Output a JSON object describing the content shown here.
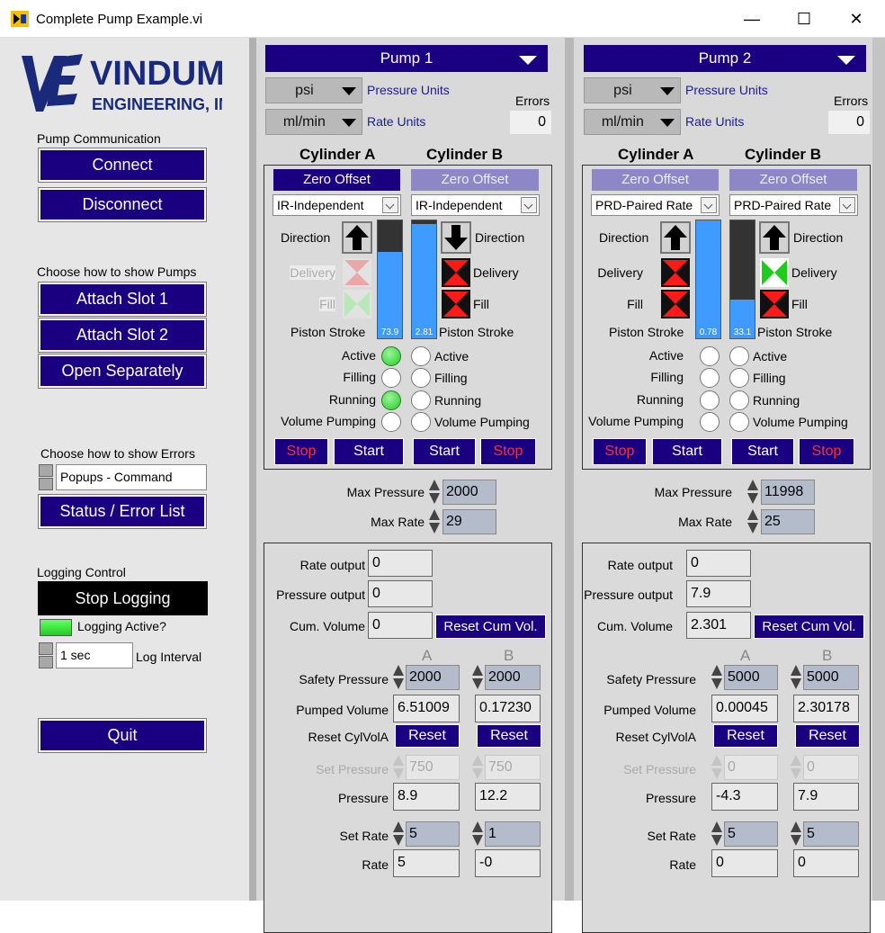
{
  "window": {
    "title": "Complete Pump Example.vi",
    "minimize": "—",
    "maximize": "☐",
    "close": "✕"
  },
  "left": {
    "logo": {
      "line1": "VINDUM",
      "line2": "ENGINEERING, INC."
    },
    "comm_label": "Pump Communication",
    "connect": "Connect",
    "disconnect": "Disconnect",
    "show_pumps_label": "Choose how to show Pumps",
    "attach1": "Attach Slot 1",
    "attach2": "Attach Slot 2",
    "open_sep": "Open Separately",
    "show_errors_label": "Choose how to show Errors",
    "error_mode": "Popups - Command",
    "status_list": "Status / Error List",
    "logging_label": "Logging Control",
    "stop_logging": "Stop Logging",
    "logging_active": "Logging Active?",
    "log_interval_value": "1 sec",
    "log_interval_label": "Log Interval",
    "quit": "Quit"
  },
  "common": {
    "pressure_units": "Pressure Units",
    "rate_units": "Rate Units",
    "errors": "Errors",
    "cylA": "Cylinder A",
    "cylB": "Cylinder B",
    "zero_offset": "Zero Offset",
    "direction": "Direction",
    "delivery": "Delivery",
    "fill": "Fill",
    "piston_stroke": "Piston Stroke",
    "active": "Active",
    "filling": "Filling",
    "running": "Running",
    "volume_pumping": "Volume Pumping",
    "stop": "Stop",
    "start": "Start",
    "max_pressure": "Max Pressure",
    "max_rate": "Max Rate",
    "rate_output": "Rate output",
    "pressure_output": "Pressure output",
    "cum_volume": "Cum. Volume",
    "reset_cum": "Reset Cum Vol.",
    "A": "A",
    "B": "B",
    "safety_pressure": "Safety Pressure",
    "pumped_volume": "Pumped Volume",
    "reset_cylvol": "Reset CylVolA",
    "reset": "Reset",
    "set_pressure": "Set Pressure",
    "pressure": "Pressure",
    "set_rate": "Set Rate",
    "rate": "Rate"
  },
  "pump1": {
    "name": "Pump 1",
    "p_unit": "psi",
    "r_unit": "ml/min",
    "errors": "0",
    "modeA": "IR-Independent",
    "modeB": "IR-Independent",
    "strokeA": "73.9",
    "strokeA_level": 0.73,
    "strokeB": "2.81",
    "strokeB_level": 0.97,
    "max_pressure": "2000",
    "max_rate": "29",
    "rate_output": "0",
    "pressure_output": "0",
    "cum_volume": "0",
    "safetyA": "2000",
    "safetyB": "2000",
    "pumpedA": "6.51009",
    "pumpedB": "0.17230",
    "setpA": "750",
    "setpB": "750",
    "pressA": "8.9",
    "pressB": "12.2",
    "setrA": "5",
    "setrB": "1",
    "rateA": "5",
    "rateB": "-0"
  },
  "pump2": {
    "name": "Pump 2",
    "p_unit": "psi",
    "r_unit": "ml/min",
    "errors": "0",
    "modeA": "PRD-Paired Rate",
    "modeB": "PRD-Paired Rate",
    "strokeA": "0.78",
    "strokeA_level": 1.0,
    "strokeB": "33.1",
    "strokeB_level": 0.33,
    "max_pressure": "11998",
    "max_rate": "25",
    "rate_output": "0",
    "pressure_output": "7.9",
    "cum_volume": "2.301",
    "safetyA": "5000",
    "safetyB": "5000",
    "pumpedA": "0.00045",
    "pumpedB": "2.30178",
    "setpA": "0",
    "setpB": "0",
    "pressA": "-4.3",
    "pressB": "7.9",
    "setrA": "5",
    "setrB": "5",
    "rateA": "0",
    "rateB": "0"
  }
}
